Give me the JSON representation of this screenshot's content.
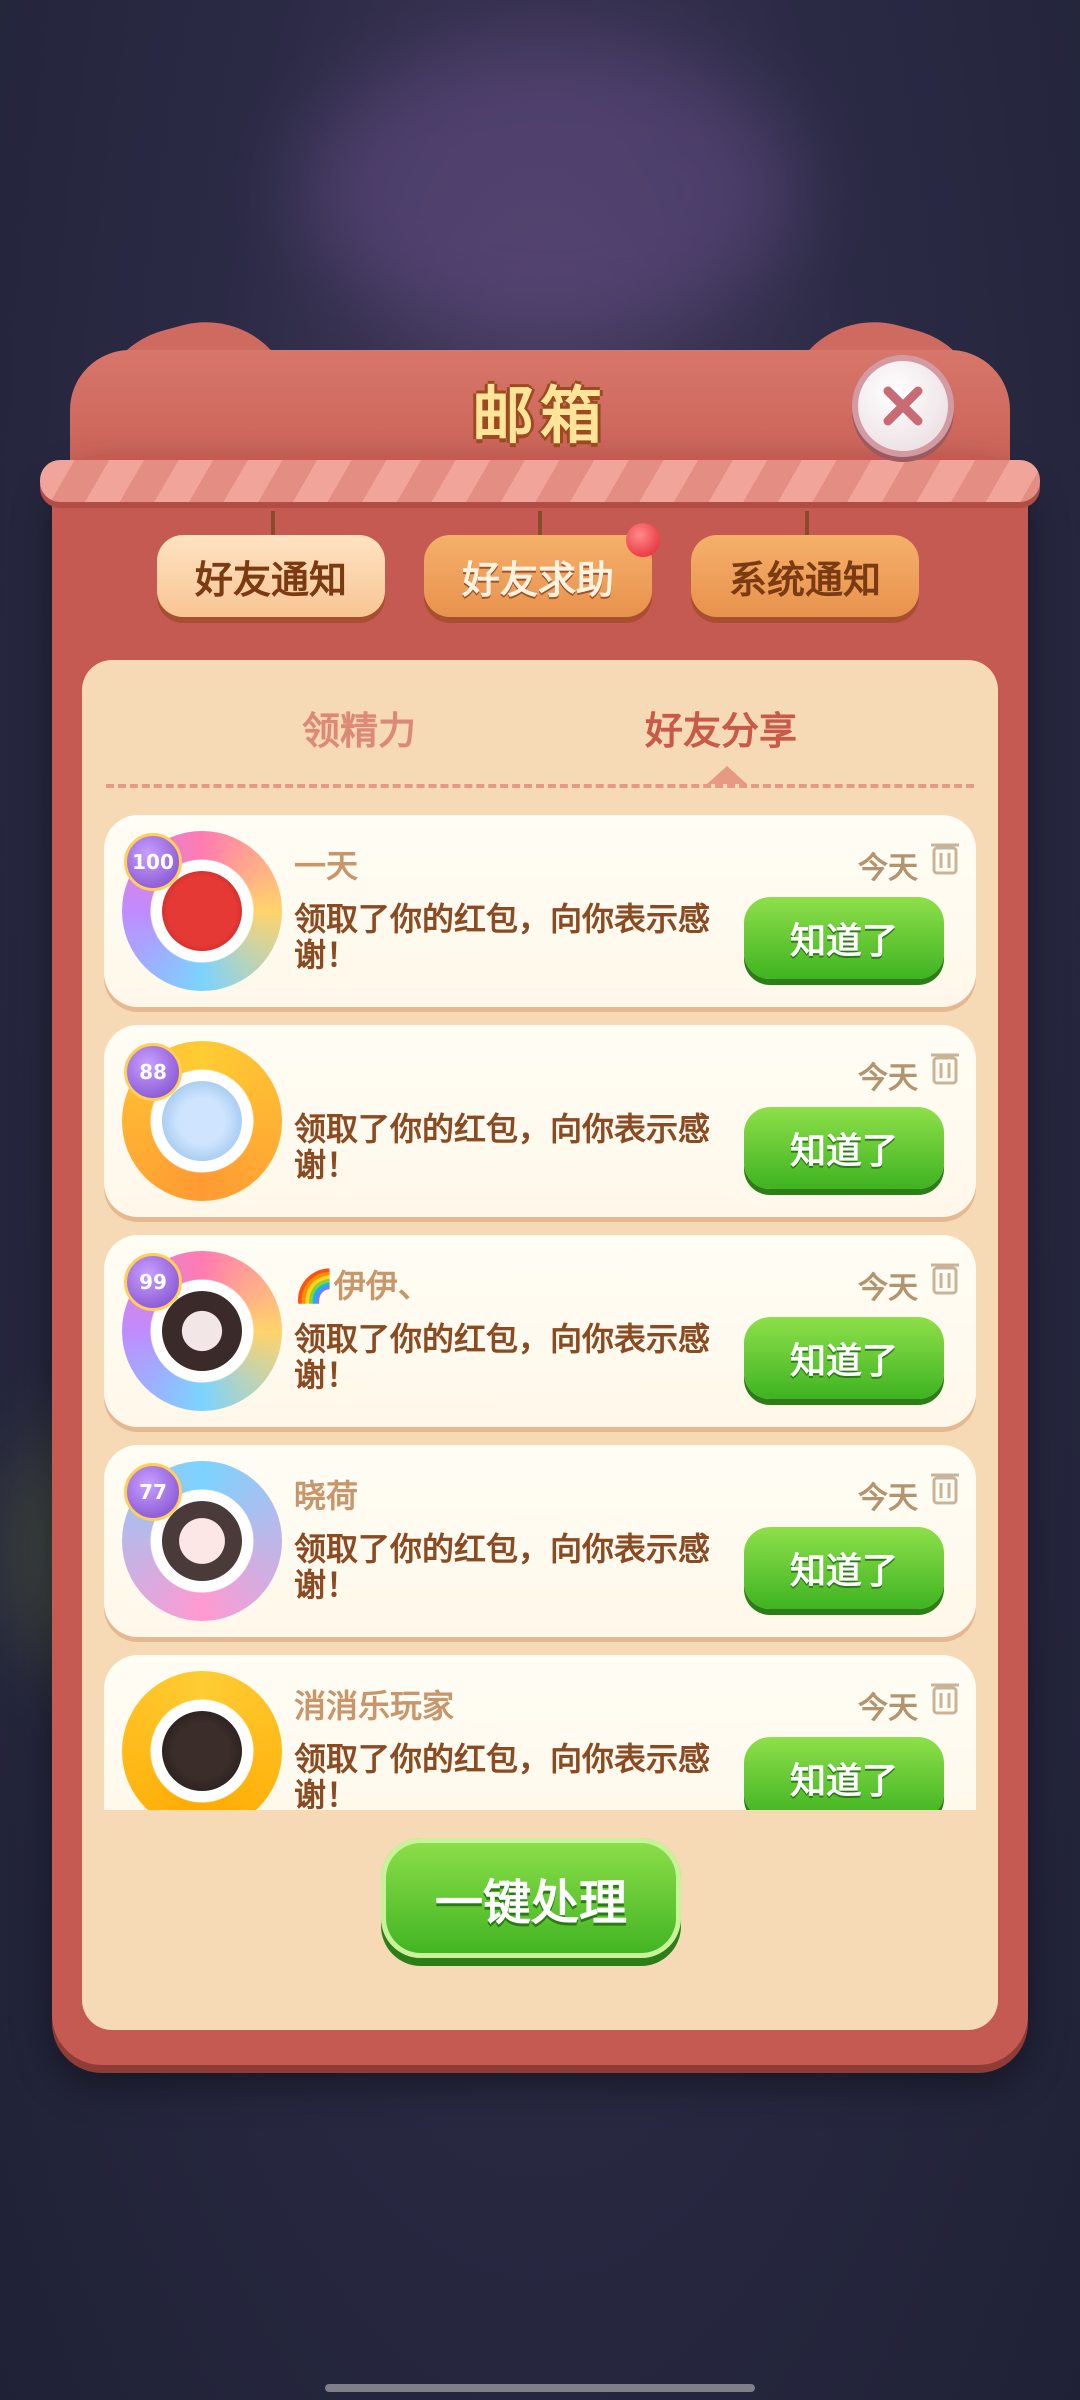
{
  "dialog": {
    "title": "邮箱"
  },
  "tabs": [
    {
      "label": "好友通知"
    },
    {
      "label": "好友求助"
    },
    {
      "label": "系统通知"
    }
  ],
  "subtabs": [
    {
      "label": "领精力"
    },
    {
      "label": "好友分享"
    }
  ],
  "messages": [
    {
      "name": "一天",
      "level": "100",
      "text": "领取了你的红包，向你表示感谢！",
      "date": "今天",
      "button": "知道了"
    },
    {
      "name": "",
      "level": "88",
      "text": "领取了你的红包，向你表示感谢！",
      "date": "今天",
      "button": "知道了"
    },
    {
      "name": "🌈伊伊、",
      "level": "99",
      "text": "领取了你的红包，向你表示感谢！",
      "date": "今天",
      "button": "知道了"
    },
    {
      "name": "晓荷",
      "level": "77",
      "text": "领取了你的红包，向你表示感谢！",
      "date": "今天",
      "button": "知道了"
    },
    {
      "name": "消消乐玩家",
      "level": "",
      "text": "领取了你的红包，向你表示感谢！",
      "date": "今天",
      "button": "知道了"
    }
  ],
  "footer": {
    "process_all": "一键处理"
  },
  "colors": {
    "panel": "#c45a52",
    "green": "#3fb321",
    "cream": "#f6d9b5"
  }
}
